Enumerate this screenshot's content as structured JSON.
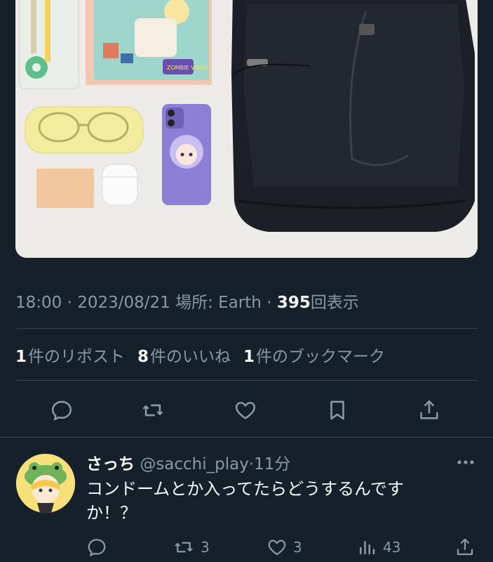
{
  "tweet": {
    "time": "18:00",
    "sep1": "·",
    "date": "2023/08/21",
    "location_label": "場所: Earth",
    "sep2": "·",
    "views_count": "395",
    "views_label": "回表示"
  },
  "stats": {
    "reposts_count": "1",
    "reposts_label": "件のリポスト",
    "likes_count": "8",
    "likes_label": "件のいいね",
    "bookmarks_count": "1",
    "bookmarks_label": "件のブックマーク"
  },
  "media": {
    "sticker_text": "ZOMBIE VIRUS"
  },
  "actions": [
    "reply-icon",
    "repost-icon",
    "like-icon",
    "bookmark-icon",
    "share-icon"
  ],
  "reply": {
    "name": "さっち",
    "handle": "@sacchi_play",
    "dot": "·",
    "time": "11分",
    "text_line1": "コンドームとか入ってたらどうするんです",
    "text_line2": "か！？",
    "reposts": "3",
    "likes": "3",
    "views": "43"
  },
  "colors": {
    "background": "#15202b",
    "text": "#f7f9f9",
    "secondary": "#8b98a5",
    "divider": "#38444d"
  }
}
